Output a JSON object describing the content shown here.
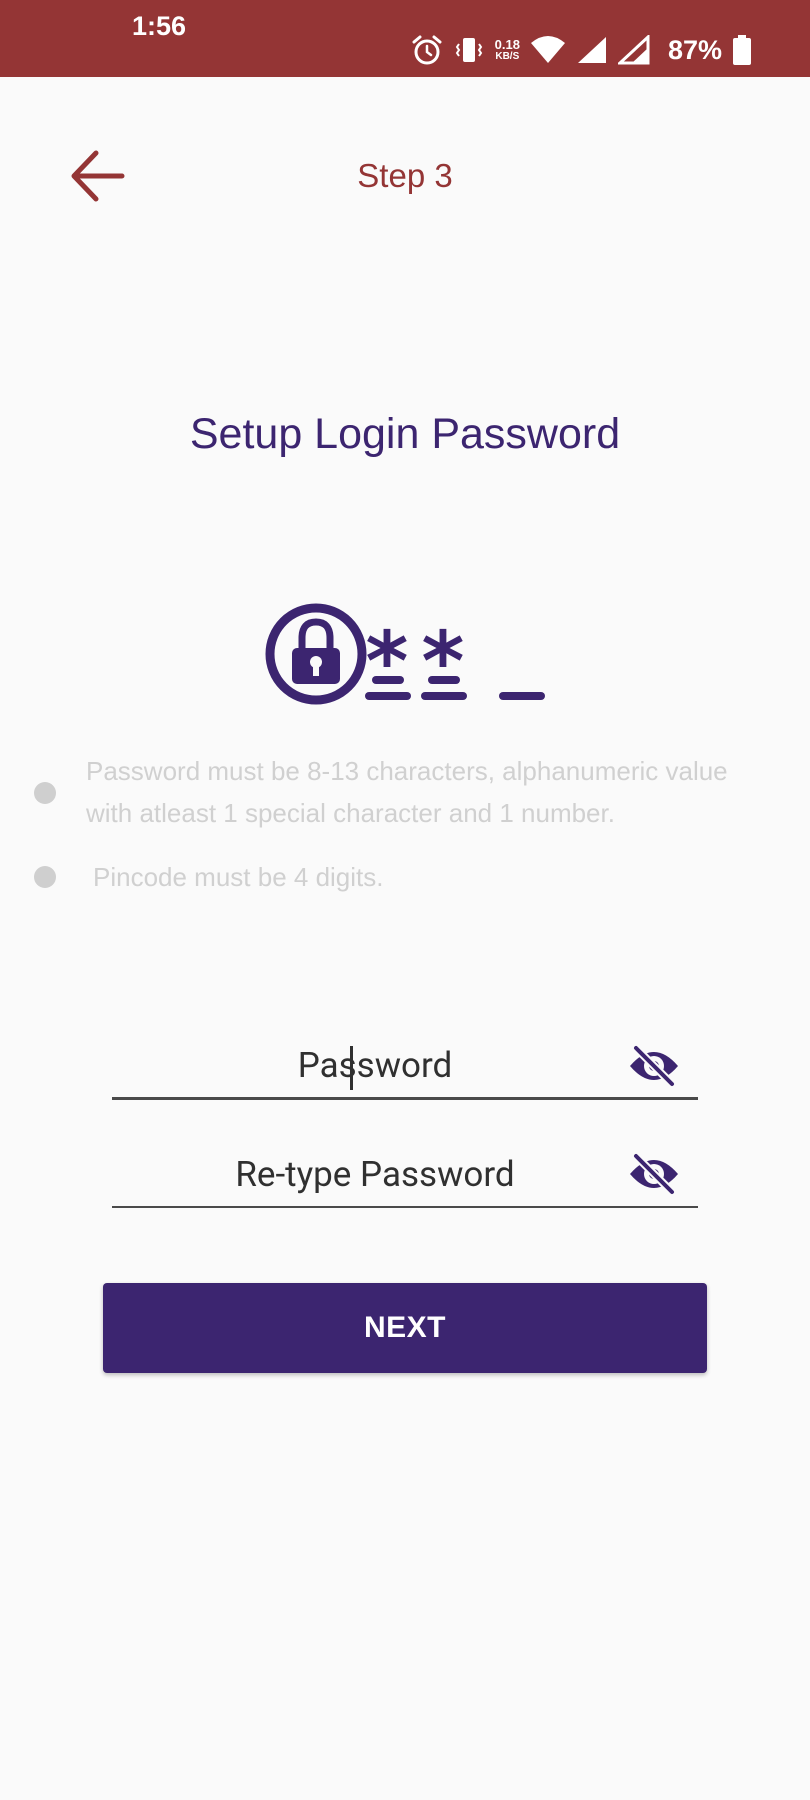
{
  "status_bar": {
    "time": "1:56",
    "net_speed_value": "0.18",
    "net_speed_unit": "KB/S",
    "battery": "87%"
  },
  "header": {
    "step_title": "Step 3"
  },
  "main": {
    "title": "Setup Login Password",
    "rules": [
      "Password must be 8-13 characters, alphanumeric value with atleast 1 special character and 1 number.",
      "Pincode must be 4 digits."
    ]
  },
  "form": {
    "password_placeholder": "Password",
    "retype_placeholder": "Re-type Password",
    "next_label": "NEXT"
  },
  "colors": {
    "status_bar": "#943535",
    "accent": "#3c2570",
    "header_text": "#943535"
  }
}
